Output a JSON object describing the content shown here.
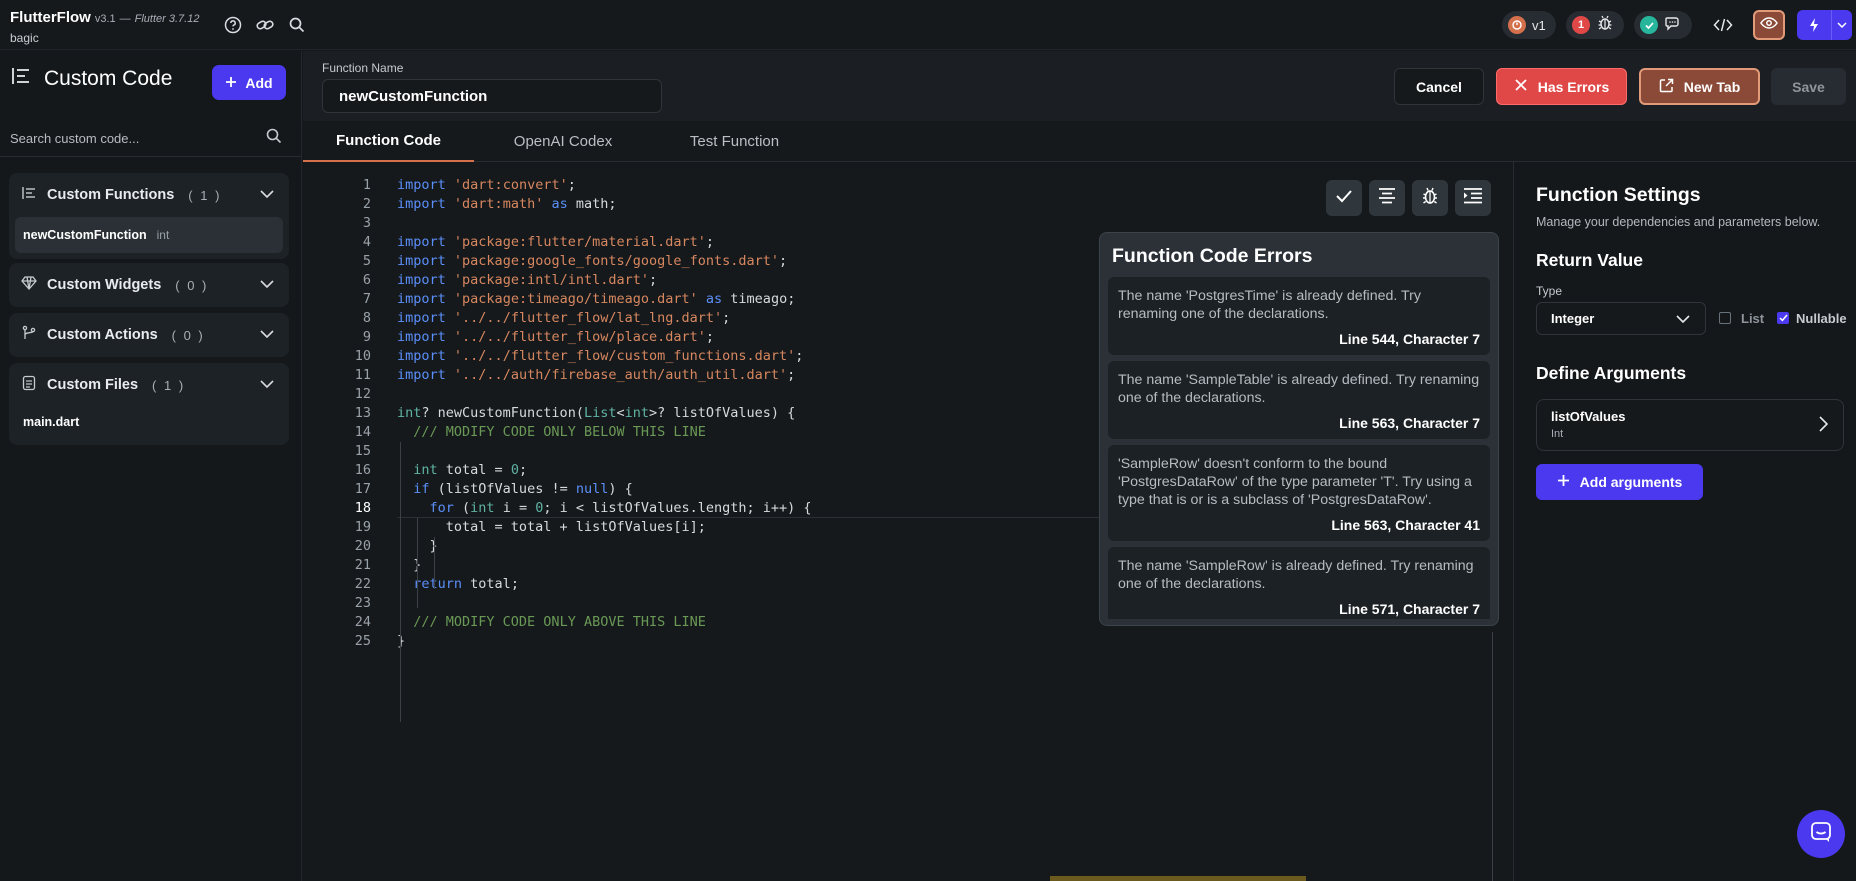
{
  "topbar": {
    "brand": "FlutterFlow",
    "version": "v3.1",
    "separator": "—",
    "flutter_version": "Flutter 3.7.12",
    "project": "bagic",
    "version_pill": "v1",
    "error_count": "1",
    "icons": [
      "help-icon",
      "link-icon",
      "search-icon",
      "bug-icon",
      "check-icon",
      "chat-icon",
      "code-icon",
      "eye-icon",
      "lightning-icon",
      "chevron-down-icon"
    ]
  },
  "sidebar": {
    "title": "Custom Code",
    "add_label": "Add",
    "search_placeholder": "Search custom code...",
    "groups": [
      {
        "title": "Custom Functions",
        "count": "( 1 )",
        "items": [
          {
            "name": "newCustomFunction",
            "type": "int"
          }
        ]
      },
      {
        "title": "Custom Widgets",
        "count": "( 0 )"
      },
      {
        "title": "Custom Actions",
        "count": "( 0 )"
      },
      {
        "title": "Custom Files",
        "count": "( 1 )",
        "items": [
          {
            "name": "main.dart"
          }
        ]
      }
    ]
  },
  "header": {
    "function_name_label": "Function Name",
    "function_name_value": "newCustomFunction",
    "cancel_label": "Cancel",
    "has_errors_label": "Has Errors",
    "new_tab_label": "New Tab",
    "save_label": "Save"
  },
  "tabs": [
    "Function Code",
    "OpenAI Codex",
    "Test Function"
  ],
  "code": {
    "line_count": 25,
    "current_line": 18
  },
  "errors": {
    "title": "Function Code Errors",
    "items": [
      {
        "message": "The name 'PostgresTime' is already defined. Try renaming one of the declarations.",
        "location": "Line 544, Character 7"
      },
      {
        "message": "The name 'SampleTable' is already defined. Try renaming one of the declarations.",
        "location": "Line 563, Character 7"
      },
      {
        "message": "'SampleRow' doesn't conform to the bound 'PostgresDataRow' of the type parameter 'T'. Try using a type that is or is a subclass of 'PostgresDataRow'.",
        "location": "Line 563, Character 41"
      },
      {
        "message": "The name 'SampleRow' is already defined. Try renaming one of the declarations.",
        "location": "Line 571, Character 7"
      }
    ]
  },
  "settings": {
    "title": "Function Settings",
    "subtitle": "Manage your dependencies and parameters below.",
    "return_value_title": "Return Value",
    "type_label": "Type",
    "type_value": "Integer",
    "list_label": "List",
    "list_checked": false,
    "nullable_label": "Nullable",
    "nullable_checked": true,
    "define_args_title": "Define Arguments",
    "argument_name": "listOfValues",
    "argument_type": "Int",
    "add_args_label": "Add arguments"
  },
  "colors": {
    "accent": "#4b39ef",
    "error": "#e04848",
    "tab_underline": "#d5704d",
    "keyword": "#5b8ff9",
    "string": "#d7875f",
    "comment": "#6a9955"
  }
}
